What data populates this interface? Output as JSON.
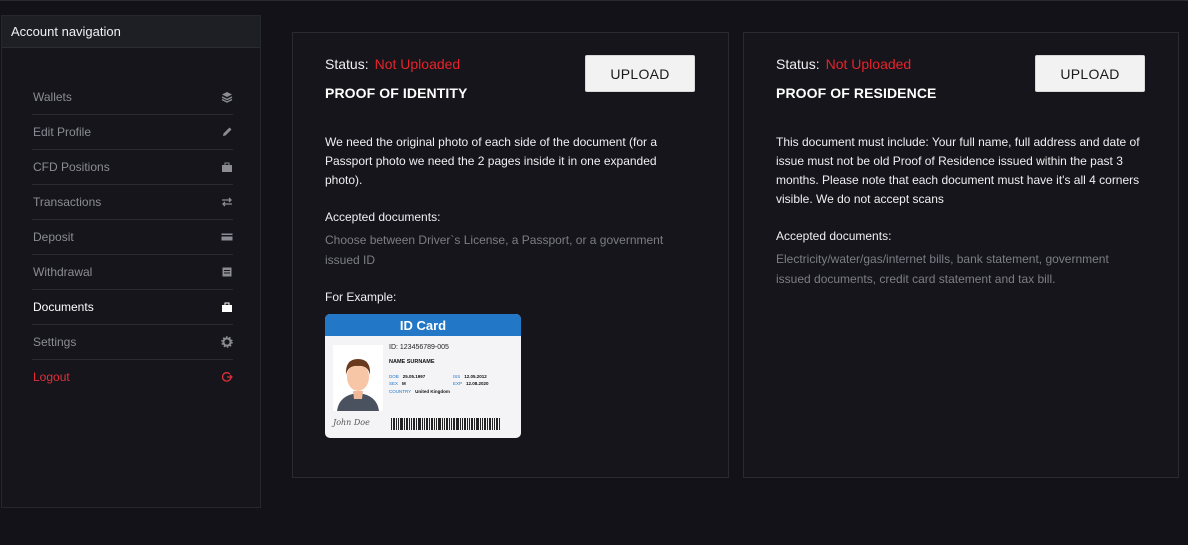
{
  "sidebar": {
    "title": "Account navigation",
    "items": [
      {
        "label": "Wallets",
        "icon": "layers-icon",
        "state": "normal"
      },
      {
        "label": "Edit Profile",
        "icon": "pencil-icon",
        "state": "normal"
      },
      {
        "label": "CFD Positions",
        "icon": "briefcase-icon",
        "state": "normal"
      },
      {
        "label": "Transactions",
        "icon": "arrows-swap-icon",
        "state": "normal"
      },
      {
        "label": "Deposit",
        "icon": "credit-card-icon",
        "state": "normal"
      },
      {
        "label": "Withdrawal",
        "icon": "receipt-icon",
        "state": "normal"
      },
      {
        "label": "Documents",
        "icon": "briefcase-icon",
        "state": "active"
      },
      {
        "label": "Settings",
        "icon": "gear-icon",
        "state": "normal"
      },
      {
        "label": "Logout",
        "icon": "power-icon",
        "state": "logout"
      }
    ]
  },
  "identity": {
    "status_label": "Status:",
    "status_value": "Not Uploaded",
    "title": "PROOF OF IDENTITY",
    "upload_label": "UPLOAD",
    "description": "We need the original photo of each side of the document (for a Passport photo we need the 2 pages inside it in one expanded photo).",
    "accepted_label": "Accepted documents:",
    "accepted_text": "Choose between Driver`s License, a Passport, or a government issued ID",
    "example_label": "For Example:",
    "example_card": {
      "header": "ID Card",
      "id_number": "ID: 123456789-005",
      "name": "NAME SURNAME",
      "dob_label": "DOB",
      "dob": "25.05.1997",
      "sex_label": "SEX",
      "sex": "M",
      "country_label": "COUNTRY",
      "country": "United Kingdom",
      "iss_label": "ISS",
      "iss": "12.05.2012",
      "exp_label": "EXP",
      "exp": "12.08.2020",
      "signature": "John Doe"
    }
  },
  "residence": {
    "status_label": "Status:",
    "status_value": "Not Uploaded",
    "title": "PROOF OF RESIDENCE",
    "upload_label": "UPLOAD",
    "description": "This document must include: Your full name, full address and date of issue must not be old Proof of Residence issued within the past 3 months. Please note that each document must have it's all 4 corners visible. We do not accept scans",
    "accepted_label": "Accepted documents:",
    "accepted_text": "Electricity/water/gas/internet bills, bank statement, government issued documents, credit card statement and tax bill."
  },
  "colors": {
    "status_red": "#e8222a",
    "logout_red": "#e0303a",
    "idcard_blue": "#2277c6",
    "background": "#121218"
  }
}
